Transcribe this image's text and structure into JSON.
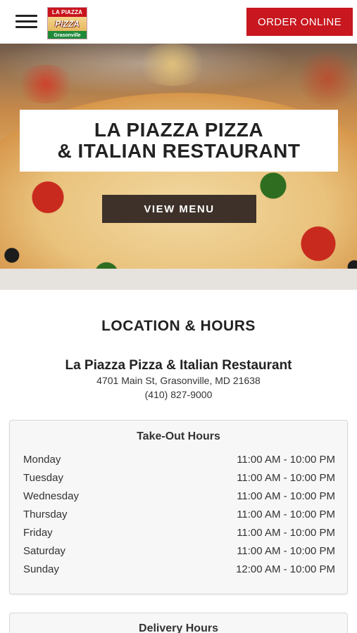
{
  "header": {
    "logo": {
      "line1": "LA PIAZZA",
      "line2": "PIZZA",
      "line3": "Grasonville"
    },
    "order_button": "ORDER ONLINE",
    "menu_icon": "hamburger-menu-icon"
  },
  "hero": {
    "title_line1": "LA PIAZZA PIZZA",
    "title_line2": "& ITALIAN RESTAURANT",
    "view_menu_button": "VIEW MENU"
  },
  "location": {
    "section_title": "LOCATION & HOURS",
    "restaurant_name": "La Piazza Pizza & Italian Restaurant",
    "address": "4701 Main St, Grasonville, MD 21638",
    "phone": "(410) 827-9000"
  },
  "takeout_hours": {
    "title": "Take-Out Hours",
    "rows": [
      {
        "day": "Monday",
        "time": "11:00 AM - 10:00 PM"
      },
      {
        "day": "Tuesday",
        "time": "11:00 AM - 10:00 PM"
      },
      {
        "day": "Wednesday",
        "time": "11:00 AM - 10:00 PM"
      },
      {
        "day": "Thursday",
        "time": "11:00 AM - 10:00 PM"
      },
      {
        "day": "Friday",
        "time": "11:00 AM - 10:00 PM"
      },
      {
        "day": "Saturday",
        "time": "11:00 AM - 10:00 PM"
      },
      {
        "day": "Sunday",
        "time": "12:00 AM - 10:00 PM"
      }
    ]
  },
  "delivery_hours": {
    "title": "Delivery Hours"
  },
  "colors": {
    "brand_red": "#c8171e",
    "menu_button": "#3d3129"
  }
}
